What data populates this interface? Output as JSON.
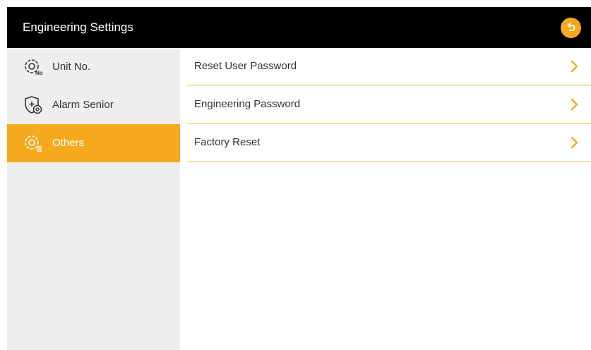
{
  "header": {
    "title": "Engineering Settings",
    "back_icon": "back-arrow-icon"
  },
  "sidebar": {
    "items": [
      {
        "label": "Unit No.",
        "icon": "gear-number-icon",
        "active": false
      },
      {
        "label": "Alarm Senior",
        "icon": "shield-plus-icon",
        "active": false
      },
      {
        "label": "Others",
        "icon": "gear-list-icon",
        "active": true
      }
    ]
  },
  "main": {
    "rows": [
      {
        "label": "Reset User Password",
        "icon": "chevron-right-icon"
      },
      {
        "label": "Engineering Password",
        "icon": "chevron-right-icon"
      },
      {
        "label": "Factory Reset",
        "icon": "chevron-right-icon"
      }
    ]
  },
  "colors": {
    "accent": "#f4aa1c",
    "header_bg": "#000000",
    "sidebar_bg": "#eeeeee",
    "divider": "#f6dfa6"
  }
}
